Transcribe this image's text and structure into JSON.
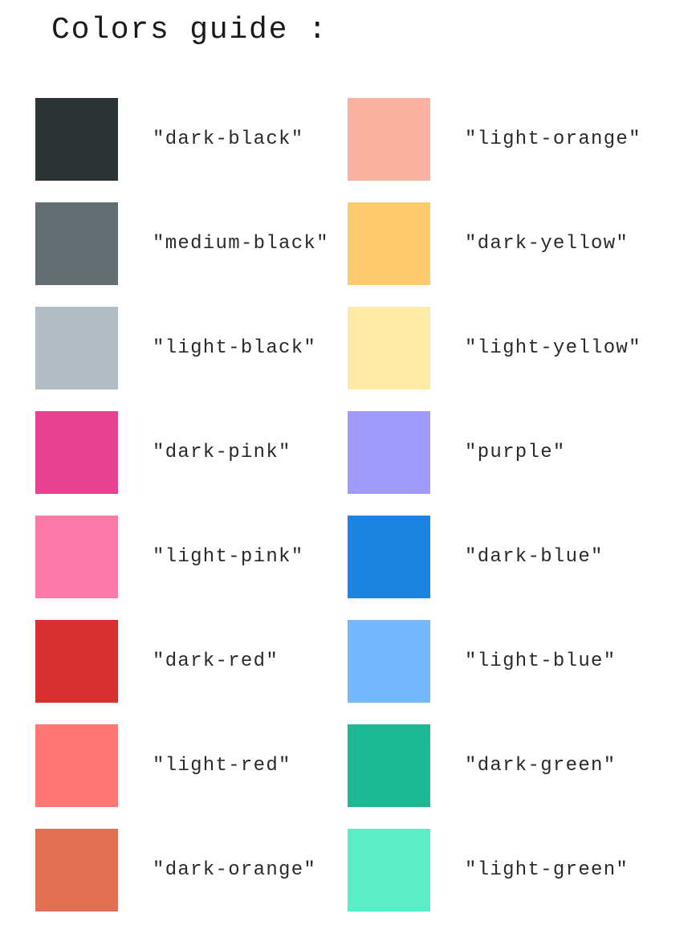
{
  "title": "Colors guide :",
  "left_column": [
    {
      "name": "\"dark-black\"",
      "color": "#2d3436"
    },
    {
      "name": "\"medium-black\"",
      "color": "#636e72"
    },
    {
      "name": "\"light-black\"",
      "color": "#b2bec3"
    },
    {
      "name": "\"dark-pink\"",
      "color": "#e84393"
    },
    {
      "name": "\"light-pink\"",
      "color": "#fd79a8"
    },
    {
      "name": "\"dark-red\"",
      "color": "#d63031"
    },
    {
      "name": "\"light-red\"",
      "color": "#ff7675"
    },
    {
      "name": "\"dark-orange\"",
      "color": "#e17055"
    }
  ],
  "right_column": [
    {
      "name": "\"light-orange\"",
      "color": "#fab1a0"
    },
    {
      "name": "\"dark-yellow\"",
      "color": "#fdcb6e"
    },
    {
      "name": "\"light-yellow\"",
      "color": "#ffeaa7"
    },
    {
      "name": "\"purple\"",
      "color": "#a29bfe"
    },
    {
      "name": "\"dark-blue\"",
      "color": "#1b84e0"
    },
    {
      "name": "\"light-blue\"",
      "color": "#74b9ff"
    },
    {
      "name": "\"dark-green\"",
      "color": "#1db894"
    },
    {
      "name": "\"light-green\"",
      "color": "#5beec4"
    }
  ]
}
